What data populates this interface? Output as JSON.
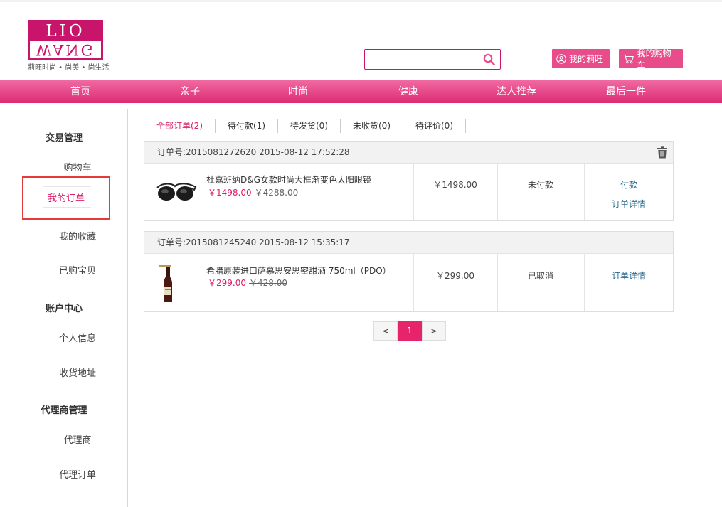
{
  "logo": {
    "line1": "LIO",
    "line2": "WANG",
    "tagline": "莉旺时尚 • 尚美 • 尚生活"
  },
  "search": {
    "value": "",
    "placeholder": ""
  },
  "header": {
    "my_label": "我的莉旺",
    "cart_label": "我的购物车"
  },
  "nav": [
    "首页",
    "亲子",
    "时尚",
    "健康",
    "达人推荐",
    "最后一件"
  ],
  "sidebar": {
    "sections": [
      {
        "title": "交易管理",
        "items": [
          "购物车",
          "我的订单",
          "我的收藏",
          "已购宝贝"
        ]
      },
      {
        "title": "账户中心",
        "items": [
          "个人信息",
          "收货地址"
        ]
      },
      {
        "title": "代理商管理",
        "items": [
          "代理商",
          "代理订单"
        ]
      }
    ],
    "active": "我的订单"
  },
  "tabs": [
    "全部订单(2)",
    "待付款(1)",
    "待发货(0)",
    "未收货(0)",
    "待评价(0)"
  ],
  "orders": [
    {
      "header": "订单号:2015081272620 2015-08-12 17:52:28",
      "product_name": "杜嘉班纳D&G女款时尚大框渐变色太阳眼镜",
      "price_now": "￥1498.00",
      "price_old": "￥4288.00",
      "total": "￥1498.00",
      "status": "未付款",
      "actions": [
        "付款",
        "订单详情"
      ]
    },
    {
      "header": "订单号:2015081245240 2015-08-12 15:35:17",
      "product_name": "希腊原装进口萨慕思安思密甜酒 750ml（PDO）",
      "price_now": "￥299.00",
      "price_old": "￥428.00",
      "total": "￥299.00",
      "status": "已取消",
      "actions": [
        "订单详情"
      ]
    }
  ],
  "pagination": {
    "prev": "<",
    "current": "1",
    "next": ">"
  },
  "colors": {
    "brand": "#e6246b",
    "nav_top": "#f06aa2",
    "nav_bottom": "#dd2a73",
    "link": "#2b6b8f",
    "highlight_box": "#e53a3a"
  }
}
